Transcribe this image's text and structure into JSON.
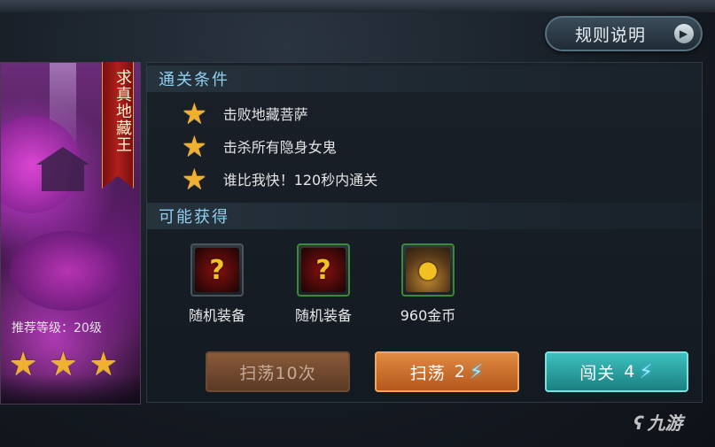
{
  "header": {
    "rules_label": "规则说明"
  },
  "stage": {
    "name": "求真地藏王",
    "recommended_level": "推荐等级：20级",
    "stars_earned": 3,
    "stars_total": 3
  },
  "conditions": {
    "title": "通关条件",
    "items": [
      {
        "text": "击败地藏菩萨"
      },
      {
        "text": "击杀所有隐身女鬼"
      },
      {
        "text": "谁比我快！120秒内通关"
      }
    ]
  },
  "rewards": {
    "title": "可能获得",
    "items": [
      {
        "label": "随机装备",
        "icon": "question-mark-icon"
      },
      {
        "label": "随机装备",
        "icon": "question-mark-icon"
      },
      {
        "label": "960金币",
        "icon": "gold-coins-icon"
      }
    ]
  },
  "actions": {
    "sweep10_label": "扫荡10次",
    "sweep_label": "扫荡",
    "sweep_cost": "2",
    "challenge_label": "闯关",
    "challenge_cost": "4"
  },
  "watermark": {
    "text": "九游"
  },
  "colors": {
    "section_title": "#8fd0f0",
    "star": "#f0b030",
    "sweep_button": "#e08a42",
    "challenge_button": "#3ec0c0"
  }
}
